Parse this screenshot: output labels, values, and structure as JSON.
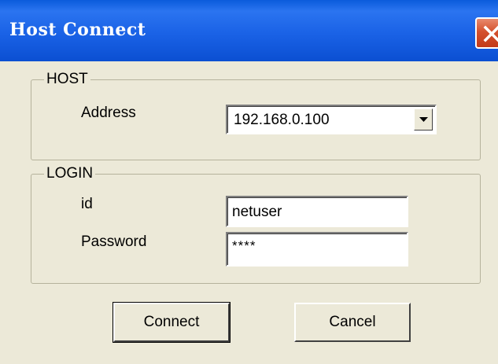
{
  "window": {
    "title": "Host Connect"
  },
  "host_group": {
    "legend": "HOST",
    "address_label": "Address",
    "address_value": "192.168.0.100"
  },
  "login_group": {
    "legend": "LOGIN",
    "id_label": "id",
    "id_value": "netuser",
    "password_label": "Password",
    "password_value": "****"
  },
  "buttons": {
    "connect": "Connect",
    "cancel": "Cancel"
  },
  "icons": {
    "close": "close-icon",
    "dropdown": "chevron-down-icon"
  },
  "colors": {
    "title_bar": "#0A5BDB",
    "close_button": "#D4512E",
    "dialog_bg": "#ECE9D8"
  }
}
